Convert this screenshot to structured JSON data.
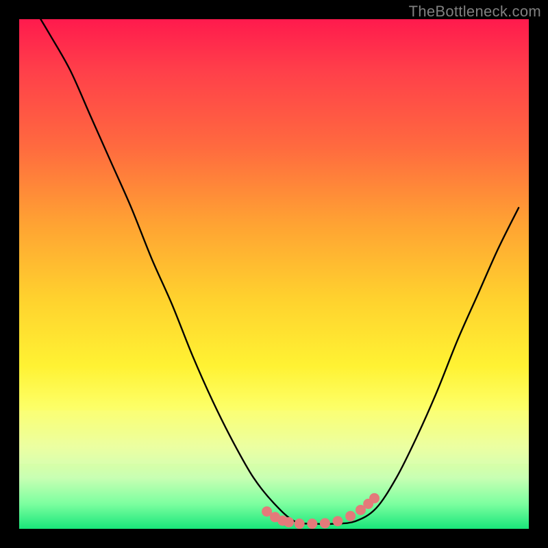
{
  "watermark": "TheBottleneck.com",
  "colors": {
    "black": "#000000",
    "marker_fill": "#e47a7a",
    "marker_stroke": "#d66060",
    "gradient_top": "#ff1a4d",
    "gradient_bottom": "#19e67a"
  },
  "chart_data": {
    "type": "line",
    "title": "",
    "xlabel": "",
    "ylabel": "",
    "xlim": [
      0,
      1
    ],
    "ylim": [
      0,
      1
    ],
    "x": [
      0.03,
      0.06,
      0.1,
      0.14,
      0.18,
      0.22,
      0.26,
      0.3,
      0.34,
      0.38,
      0.42,
      0.46,
      0.5,
      0.54,
      0.58,
      0.62,
      0.66,
      0.7,
      0.74,
      0.78,
      0.82,
      0.86,
      0.9,
      0.94,
      0.98
    ],
    "values": [
      1.02,
      0.97,
      0.9,
      0.81,
      0.72,
      0.63,
      0.53,
      0.44,
      0.34,
      0.25,
      0.17,
      0.1,
      0.05,
      0.015,
      0.01,
      0.01,
      0.015,
      0.04,
      0.1,
      0.18,
      0.27,
      0.37,
      0.46,
      0.55,
      0.63
    ],
    "markers_x": [
      0.486,
      0.502,
      0.517,
      0.529,
      0.55,
      0.575,
      0.6,
      0.625,
      0.65,
      0.67,
      0.685,
      0.697
    ],
    "markers_y": [
      0.034,
      0.023,
      0.016,
      0.013,
      0.01,
      0.01,
      0.011,
      0.015,
      0.025,
      0.037,
      0.049,
      0.06
    ]
  }
}
